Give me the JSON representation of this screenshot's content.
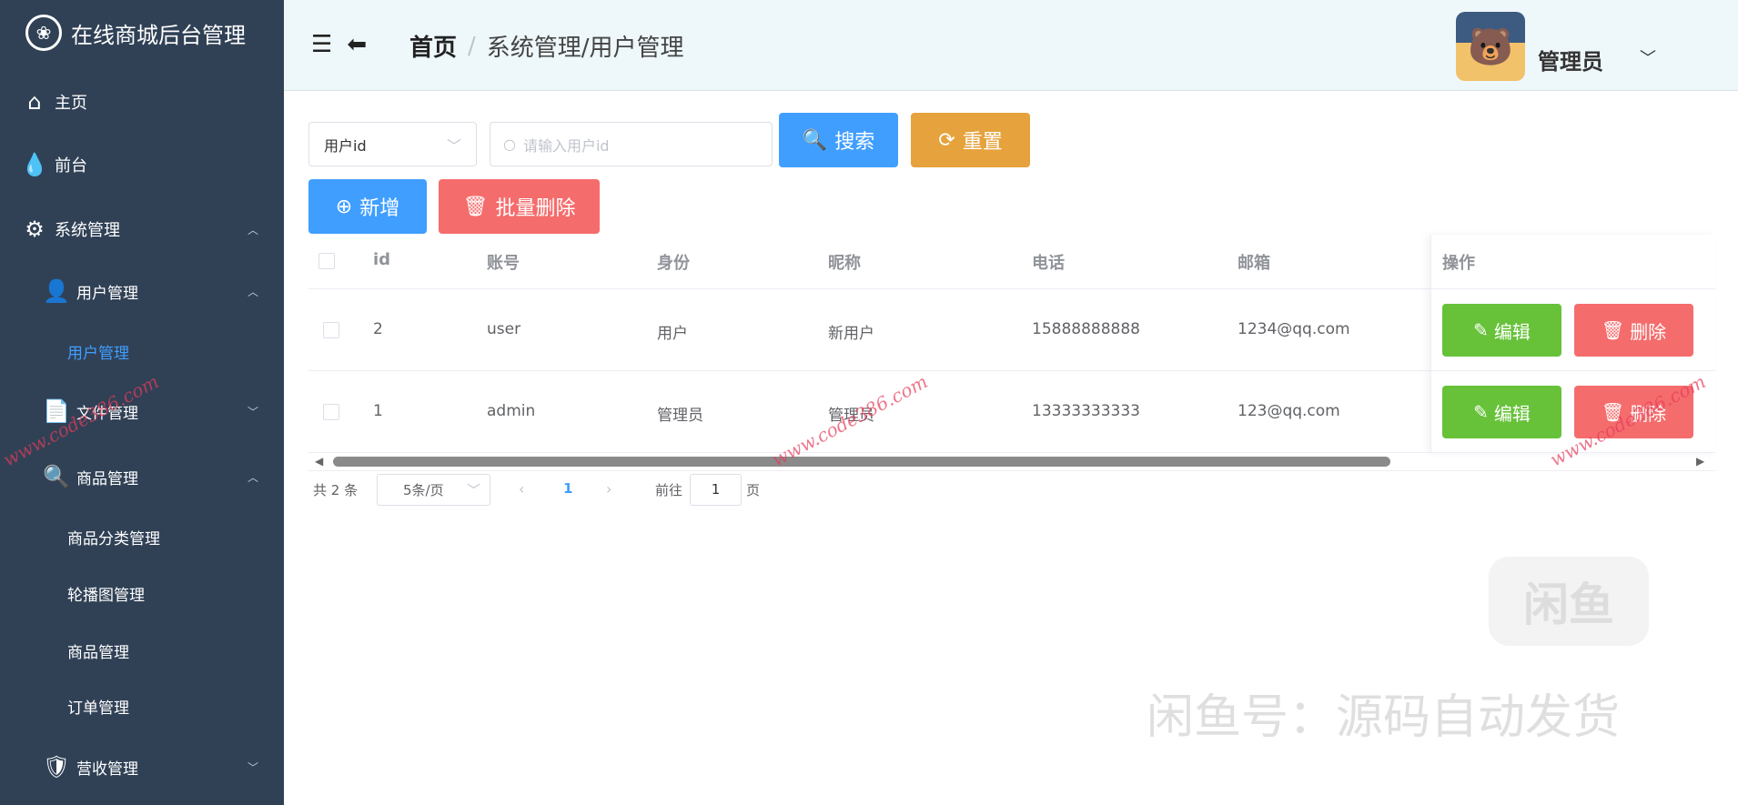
{
  "app": {
    "title": "在线商城后台管理"
  },
  "sidebar": {
    "items": [
      {
        "label": "主页",
        "icon": "home-icon"
      },
      {
        "label": "前台",
        "icon": "drop-icon"
      },
      {
        "label": "系统管理",
        "icon": "gear-icon"
      },
      {
        "label": "用户管理",
        "icon": "user-icon"
      },
      {
        "label": "用户管理"
      },
      {
        "label": "文件管理",
        "icon": "file-icon"
      },
      {
        "label": "商品管理",
        "icon": "search-user-icon"
      },
      {
        "label": "商品分类管理"
      },
      {
        "label": "轮播图管理"
      },
      {
        "label": "商品管理"
      },
      {
        "label": "订单管理"
      },
      {
        "label": "营收管理",
        "icon": "badge-icon"
      }
    ]
  },
  "header": {
    "breadcrumb": [
      "首页",
      "系统管理/用户管理"
    ],
    "separator": "/",
    "user": "管理员"
  },
  "filter": {
    "select_value": "用户id",
    "search_placeholder": "请输入用户id",
    "search_label": "搜索",
    "reset_label": "重置",
    "add_label": "新增",
    "batch_delete_label": "批量删除"
  },
  "table": {
    "columns": [
      "id",
      "账号",
      "身份",
      "昵称",
      "电话",
      "邮箱",
      "操作"
    ],
    "rows": [
      {
        "id": "2",
        "account": "user",
        "role": "用户",
        "nickname": "新用户",
        "phone": "15888888888",
        "email": "1234@qq.com"
      },
      {
        "id": "1",
        "account": "admin",
        "role": "管理员",
        "nickname": "管理员",
        "phone": "13333333333",
        "email": "123@qq.com"
      }
    ],
    "edit_label": "编辑",
    "delete_label": "删除"
  },
  "pagination": {
    "total": "共 2 条",
    "page_size": "5条/页",
    "current": "1",
    "goto_prefix": "前往",
    "goto_value": "1",
    "goto_suffix": "页"
  },
  "watermarks": {
    "site": "www.code386.com",
    "logo": "闲鱼",
    "text": "闲鱼号：源码自动发货"
  },
  "colors": {
    "sidebar": "#304156",
    "primary": "#409eff",
    "warning": "#e6a23c",
    "danger": "#f56c6c",
    "success": "#67c23a"
  }
}
